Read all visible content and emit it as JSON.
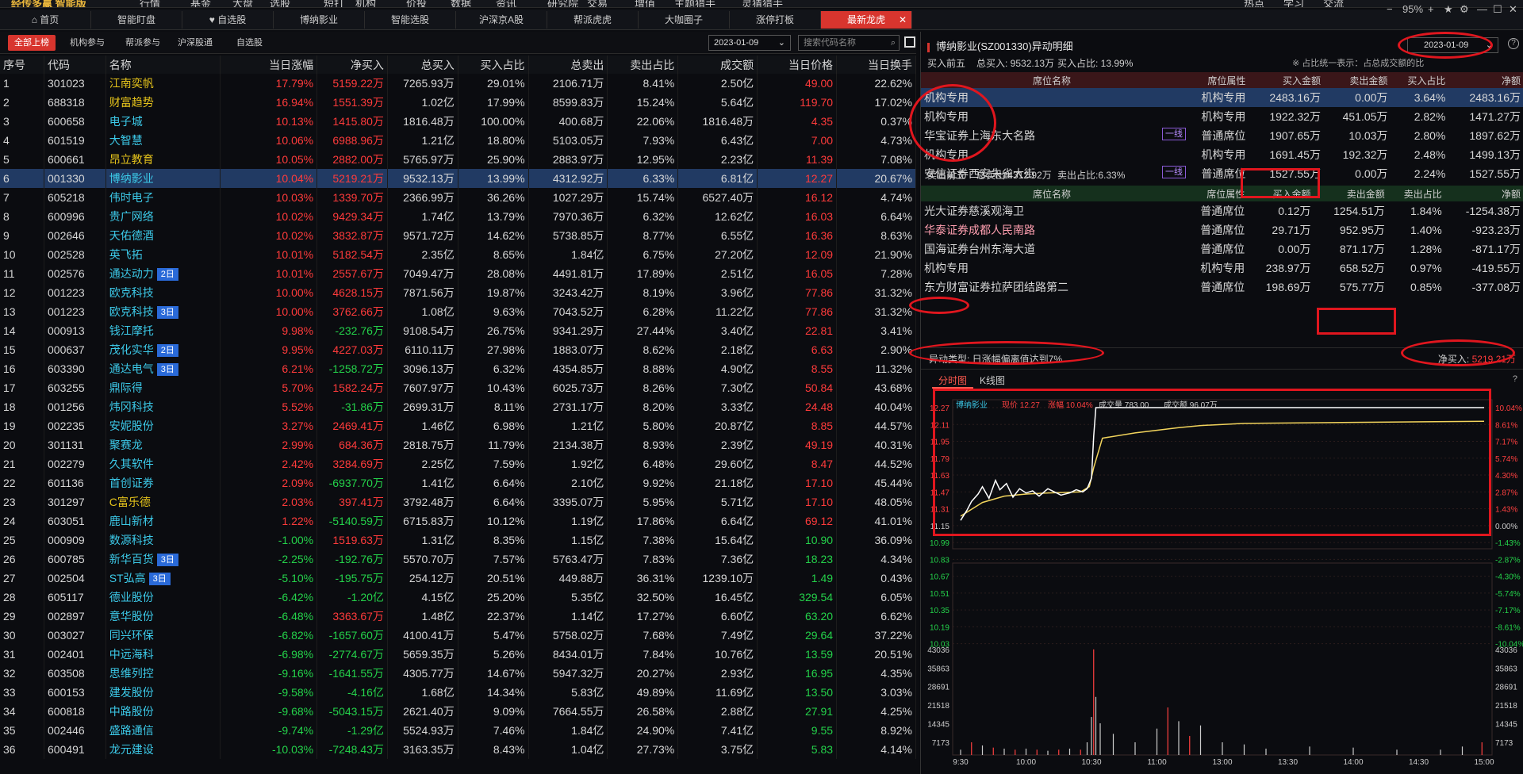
{
  "app": {
    "brand": "经传多赢 智能版",
    "menu": [
      "行情",
      "基金",
      "大盘",
      "选股",
      "短打",
      "机构",
      "价投",
      "数据",
      "资讯",
      "研究院",
      "交易",
      "增值",
      "主题猎手",
      "灵猜猎手"
    ],
    "right_menu": [
      "热点",
      "学习",
      "交流"
    ],
    "zoom": "95%"
  },
  "tabs": [
    "首页",
    "智能盯盘",
    "自选股",
    "博纳影业",
    "智能选股",
    "沪深京A股",
    "帮派虎虎",
    "大咖圈子",
    "涨停打板",
    "最新龙虎"
  ],
  "subtabs": [
    "全部上榜",
    "机构参与",
    "帮派参与",
    "沪深股通",
    "自选股"
  ],
  "list_date": "2023-01-09",
  "search_placeholder": "搜索代码名称",
  "table": {
    "columns": [
      "序号",
      "代码",
      "名称",
      "当日涨幅",
      "净买入",
      "总买入",
      "买入占比",
      "总卖出",
      "卖出占比",
      "成交额",
      "当日价格",
      "当日换手"
    ],
    "rows": [
      [
        "1",
        "301023",
        "江南奕帆",
        "",
        "17.79%",
        "5159.22万",
        "7265.93万",
        "29.01%",
        "2106.71万",
        "8.41%",
        "2.50亿",
        "49.00",
        "22.62%"
      ],
      [
        "2",
        "688318",
        "财富趋势",
        "",
        "16.94%",
        "1551.39万",
        "1.02亿",
        "17.99%",
        "8599.83万",
        "15.24%",
        "5.64亿",
        "119.70",
        "17.02%"
      ],
      [
        "3",
        "600658",
        "电子城",
        "",
        "10.13%",
        "1415.80万",
        "1816.48万",
        "100.00%",
        "400.68万",
        "22.06%",
        "1816.48万",
        "4.35",
        "0.37%"
      ],
      [
        "4",
        "601519",
        "大智慧",
        "",
        "10.06%",
        "6988.96万",
        "1.21亿",
        "18.80%",
        "5103.05万",
        "7.93%",
        "6.43亿",
        "7.00",
        "4.73%"
      ],
      [
        "5",
        "600661",
        "昂立教育",
        "",
        "10.05%",
        "2882.00万",
        "5765.97万",
        "25.90%",
        "2883.97万",
        "12.95%",
        "2.23亿",
        "11.39",
        "7.08%"
      ],
      [
        "6",
        "001330",
        "博纳影业",
        "",
        "10.04%",
        "5219.21万",
        "9532.13万",
        "13.99%",
        "4312.92万",
        "6.33%",
        "6.81亿",
        "12.27",
        "20.67%"
      ],
      [
        "7",
        "605218",
        "伟时电子",
        "",
        "10.03%",
        "1339.70万",
        "2366.99万",
        "36.26%",
        "1027.29万",
        "15.74%",
        "6527.40万",
        "16.12",
        "4.74%"
      ],
      [
        "8",
        "600996",
        "贵广网络",
        "",
        "10.02%",
        "9429.34万",
        "1.74亿",
        "13.79%",
        "7970.36万",
        "6.32%",
        "12.62亿",
        "16.03",
        "6.64%"
      ],
      [
        "9",
        "002646",
        "天佑德酒",
        "",
        "10.02%",
        "3832.87万",
        "9571.72万",
        "14.62%",
        "5738.85万",
        "8.77%",
        "6.55亿",
        "16.36",
        "8.63%"
      ],
      [
        "10",
        "002528",
        "英飞拓",
        "",
        "10.01%",
        "5182.54万",
        "2.35亿",
        "8.65%",
        "1.84亿",
        "6.75%",
        "27.20亿",
        "12.09",
        "21.90%"
      ],
      [
        "11",
        "002576",
        "通达动力",
        "2日",
        "10.01%",
        "2557.67万",
        "7049.47万",
        "28.08%",
        "4491.81万",
        "17.89%",
        "2.51亿",
        "16.05",
        "7.28%"
      ],
      [
        "12",
        "001223",
        "欧克科技",
        "",
        "10.00%",
        "4628.15万",
        "7871.56万",
        "19.87%",
        "3243.42万",
        "8.19%",
        "3.96亿",
        "77.86",
        "31.32%"
      ],
      [
        "13",
        "001223",
        "欧克科技",
        "3日",
        "10.00%",
        "3762.66万",
        "1.08亿",
        "9.63%",
        "7043.52万",
        "6.28%",
        "11.22亿",
        "77.86",
        "31.32%"
      ],
      [
        "14",
        "000913",
        "钱江摩托",
        "",
        "9.98%",
        "-232.76万",
        "9108.54万",
        "26.75%",
        "9341.29万",
        "27.44%",
        "3.40亿",
        "22.81",
        "3.41%"
      ],
      [
        "15",
        "000637",
        "茂化实华",
        "2日",
        "9.95%",
        "4227.03万",
        "6110.11万",
        "27.98%",
        "1883.07万",
        "8.62%",
        "2.18亿",
        "6.63",
        "2.90%"
      ],
      [
        "16",
        "603390",
        "通达电气",
        "3日",
        "6.21%",
        "-1258.72万",
        "3096.13万",
        "6.32%",
        "4354.85万",
        "8.88%",
        "4.90亿",
        "8.55",
        "11.32%"
      ],
      [
        "17",
        "603255",
        "鼎际得",
        "",
        "5.70%",
        "1582.24万",
        "7607.97万",
        "10.43%",
        "6025.73万",
        "8.26%",
        "7.30亿",
        "50.84",
        "43.68%"
      ],
      [
        "18",
        "001256",
        "炜冈科技",
        "",
        "5.52%",
        "-31.86万",
        "2699.31万",
        "8.11%",
        "2731.17万",
        "8.20%",
        "3.33亿",
        "24.48",
        "40.04%"
      ],
      [
        "19",
        "002235",
        "安妮股份",
        "",
        "3.27%",
        "2469.41万",
        "1.46亿",
        "6.98%",
        "1.21亿",
        "5.80%",
        "20.87亿",
        "8.85",
        "44.57%"
      ],
      [
        "20",
        "301131",
        "聚赛龙",
        "",
        "2.99%",
        "684.36万",
        "2818.75万",
        "11.79%",
        "2134.38万",
        "8.93%",
        "2.39亿",
        "49.19",
        "40.31%"
      ],
      [
        "21",
        "002279",
        "久其软件",
        "",
        "2.42%",
        "3284.69万",
        "2.25亿",
        "7.59%",
        "1.92亿",
        "6.48%",
        "29.60亿",
        "8.47",
        "44.52%"
      ],
      [
        "22",
        "601136",
        "首创证券",
        "",
        "2.09%",
        "-6937.70万",
        "1.41亿",
        "6.64%",
        "2.10亿",
        "9.92%",
        "21.18亿",
        "17.10",
        "45.44%"
      ],
      [
        "23",
        "301297",
        "C富乐德",
        "",
        "2.03%",
        "397.41万",
        "3792.48万",
        "6.64%",
        "3395.07万",
        "5.95%",
        "5.71亿",
        "17.10",
        "48.05%"
      ],
      [
        "24",
        "603051",
        "鹿山新材",
        "",
        "1.22%",
        "-5140.59万",
        "6715.83万",
        "10.12%",
        "1.19亿",
        "17.86%",
        "6.64亿",
        "69.12",
        "41.01%"
      ],
      [
        "25",
        "000909",
        "数源科技",
        "",
        "-1.00%",
        "1519.63万",
        "1.31亿",
        "8.35%",
        "1.15亿",
        "7.38%",
        "15.64亿",
        "10.90",
        "36.09%"
      ],
      [
        "26",
        "600785",
        "新华百货",
        "3日",
        "-2.25%",
        "-192.76万",
        "5570.70万",
        "7.57%",
        "5763.47万",
        "7.83%",
        "7.36亿",
        "18.23",
        "4.34%"
      ],
      [
        "27",
        "002504",
        "ST弘高",
        "3日",
        "-5.10%",
        "-195.75万",
        "254.12万",
        "20.51%",
        "449.88万",
        "36.31%",
        "1239.10万",
        "1.49",
        "0.43%"
      ],
      [
        "28",
        "605117",
        "德业股份",
        "",
        "-6.42%",
        "-1.20亿",
        "4.15亿",
        "25.20%",
        "5.35亿",
        "32.50%",
        "16.45亿",
        "329.54",
        "6.05%"
      ],
      [
        "29",
        "002897",
        "意华股份",
        "",
        "-6.48%",
        "3363.67万",
        "1.48亿",
        "22.37%",
        "1.14亿",
        "17.27%",
        "6.60亿",
        "63.20",
        "6.62%"
      ],
      [
        "30",
        "003027",
        "同兴环保",
        "",
        "-6.82%",
        "-1657.60万",
        "4100.41万",
        "5.47%",
        "5758.02万",
        "7.68%",
        "7.49亿",
        "29.64",
        "37.22%"
      ],
      [
        "31",
        "002401",
        "中远海科",
        "",
        "-6.98%",
        "-2774.67万",
        "5659.35万",
        "5.26%",
        "8434.01万",
        "7.84%",
        "10.76亿",
        "13.59",
        "20.51%"
      ],
      [
        "32",
        "603508",
        "思维列控",
        "",
        "-9.16%",
        "-1641.55万",
        "4305.77万",
        "14.67%",
        "5947.32万",
        "20.27%",
        "2.93亿",
        "16.95",
        "4.35%"
      ],
      [
        "33",
        "600153",
        "建发股份",
        "",
        "-9.58%",
        "-4.16亿",
        "1.68亿",
        "14.34%",
        "5.83亿",
        "49.89%",
        "11.69亿",
        "13.50",
        "3.03%"
      ],
      [
        "34",
        "600818",
        "中路股份",
        "",
        "-9.68%",
        "-5043.15万",
        "2621.40万",
        "9.09%",
        "7664.55万",
        "26.58%",
        "2.88亿",
        "27.91",
        "4.25%"
      ],
      [
        "35",
        "002446",
        "盛路通信",
        "",
        "-9.74%",
        "-1.29亿",
        "5524.93万",
        "7.46%",
        "1.84亿",
        "24.90%",
        "7.41亿",
        "9.55",
        "8.92%"
      ],
      [
        "36",
        "600491",
        "龙元建设",
        "",
        "-10.03%",
        "-7248.43万",
        "3163.35万",
        "8.43%",
        "1.04亿",
        "27.73%",
        "3.75亿",
        "5.83",
        "4.14%"
      ]
    ]
  },
  "detail": {
    "title": "博纳影业(SZ001330)异动明细",
    "date": "2023-01-09",
    "buy_summary": {
      "label": "买入前五",
      "total": "总买入: 9532.13万",
      "ratio": "买入占比: 13.99%",
      "note": "※ 占比统一表示：占总成交额的比"
    },
    "buy_columns": [
      "席位名称",
      "席位属性",
      "买入金额",
      "卖出金额",
      "买入占比",
      "净额"
    ],
    "buy_rows": [
      [
        "机构专用",
        "",
        "机构专用",
        "2483.16万",
        "0.00万",
        "3.64%",
        "2483.16万"
      ],
      [
        "机构专用",
        "",
        "机构专用",
        "1922.32万",
        "451.05万",
        "2.82%",
        "1471.27万"
      ],
      [
        "华宝证券上海东大名路",
        "一线",
        "普通席位",
        "1907.65万",
        "10.03万",
        "2.80%",
        "1897.62万"
      ],
      [
        "机构专用",
        "",
        "机构专用",
        "1691.45万",
        "192.32万",
        "2.48%",
        "1499.13万"
      ],
      [
        "安信证券西安朱雀大街",
        "一线",
        "普通席位",
        "1527.55万",
        "0.00万",
        "2.24%",
        "1527.55万"
      ]
    ],
    "sell_summary": {
      "label": "卖出前五",
      "total": "总卖出:4312.92万",
      "ratio": "卖出占比:6.33%"
    },
    "sell_columns": [
      "席位名称",
      "席位属性",
      "买入金额",
      "卖出金额",
      "卖出占比",
      "净额"
    ],
    "sell_rows": [
      [
        "光大证券慈溪观海卫",
        "普通席位",
        "0.12万",
        "1254.51万",
        "1.84%",
        "-1254.38万"
      ],
      [
        "华泰证券成都人民南路",
        "普通席位",
        "29.71万",
        "952.95万",
        "1.40%",
        "-923.23万"
      ],
      [
        "国海证券台州东海大道",
        "普通席位",
        "0.00万",
        "871.17万",
        "1.28%",
        "-871.17万"
      ],
      [
        "机构专用",
        "机构专用",
        "238.97万",
        "658.52万",
        "0.97%",
        "-419.55万"
      ],
      [
        "东方财富证券拉萨团结路第二",
        "普通席位",
        "198.69万",
        "575.77万",
        "0.85%",
        "-377.08万"
      ]
    ],
    "anomaly": "异动类型: 日涨幅偏离值达到7%",
    "net_buy_label": "净买入:",
    "net_buy": "5219.21万"
  },
  "chart_tabs": [
    "分时图",
    "K线图"
  ],
  "chart_data": {
    "type": "line",
    "header": {
      "name": "博纳影业",
      "price_label": "现价",
      "price": "12.27",
      "chg_label": "涨幅",
      "chg": "10.04%",
      "vol_label": "成交量",
      "vol": "783.00",
      "amt_label": "成交额",
      "amt": "96.07万"
    },
    "y_left": [
      "12.27",
      "12.11",
      "11.95",
      "11.79",
      "11.63",
      "11.47",
      "11.31",
      "11.15",
      "10.99",
      "10.83",
      "10.67",
      "10.51",
      "10.35",
      "10.19",
      "10.03"
    ],
    "y_right": [
      "10.04%",
      "8.61%",
      "7.17%",
      "5.74%",
      "4.30%",
      "2.87%",
      "1.43%",
      "0.00%",
      "-1.43%",
      "-2.87%",
      "-4.30%",
      "-5.74%",
      "-7.17%",
      "-8.61%",
      "-10.04%"
    ],
    "vol_axis": [
      "43036",
      "35863",
      "28691",
      "21518",
      "14345",
      "7173"
    ],
    "x_labels": [
      "9:30",
      "10:00",
      "10:30",
      "11:00",
      "13:00",
      "13:30",
      "14:00",
      "14:30",
      "15:00"
    ],
    "ylim": [
      10.03,
      12.27
    ],
    "price": [
      [
        0,
        11.2
      ],
      [
        3,
        11.3
      ],
      [
        5,
        11.38
      ],
      [
        8,
        11.45
      ],
      [
        10,
        11.52
      ],
      [
        13,
        11.41
      ],
      [
        16,
        11.58
      ],
      [
        18,
        11.49
      ],
      [
        21,
        11.55
      ],
      [
        24,
        11.42
      ],
      [
        27,
        11.5
      ],
      [
        30,
        11.46
      ],
      [
        33,
        11.48
      ],
      [
        36,
        11.43
      ],
      [
        40,
        11.5
      ],
      [
        43,
        11.47
      ],
      [
        46,
        11.44
      ],
      [
        50,
        11.46
      ],
      [
        53,
        11.49
      ],
      [
        56,
        11.47
      ],
      [
        58,
        11.5
      ],
      [
        60,
        11.6
      ],
      [
        61,
        12.0
      ],
      [
        62,
        12.27
      ],
      [
        240,
        12.27
      ]
    ],
    "avg": [
      [
        0,
        11.24
      ],
      [
        10,
        11.37
      ],
      [
        20,
        11.43
      ],
      [
        30,
        11.45
      ],
      [
        40,
        11.46
      ],
      [
        55,
        11.47
      ],
      [
        59,
        11.52
      ],
      [
        61,
        11.7
      ],
      [
        65,
        11.98
      ],
      [
        80,
        12.03
      ],
      [
        100,
        12.08
      ],
      [
        110,
        12.1
      ],
      [
        130,
        12.12
      ],
      [
        180,
        12.13
      ],
      [
        240,
        12.14
      ]
    ],
    "volume": [
      [
        0,
        0.05
      ],
      [
        5,
        0.12
      ],
      [
        10,
        0.09
      ],
      [
        15,
        0.07
      ],
      [
        20,
        0.06
      ],
      [
        25,
        0.05
      ],
      [
        30,
        0.06
      ],
      [
        35,
        0.05
      ],
      [
        40,
        0.04
      ],
      [
        45,
        0.05
      ],
      [
        50,
        0.06
      ],
      [
        55,
        0.05
      ],
      [
        58,
        0.12
      ],
      [
        60,
        0.36
      ],
      [
        61,
        1.0
      ],
      [
        62,
        0.55
      ],
      [
        64,
        0.3
      ],
      [
        70,
        0.2
      ],
      [
        80,
        0.12
      ],
      [
        90,
        0.25
      ],
      [
        95,
        0.45
      ],
      [
        100,
        0.32
      ],
      [
        105,
        0.18
      ],
      [
        110,
        0.28
      ],
      [
        120,
        0.12
      ],
      [
        130,
        0.1
      ],
      [
        140,
        0.06
      ],
      [
        160,
        0.08
      ],
      [
        180,
        0.07
      ],
      [
        200,
        0.05
      ],
      [
        220,
        0.05
      ],
      [
        230,
        0.08
      ],
      [
        239,
        0.12
      ]
    ]
  }
}
